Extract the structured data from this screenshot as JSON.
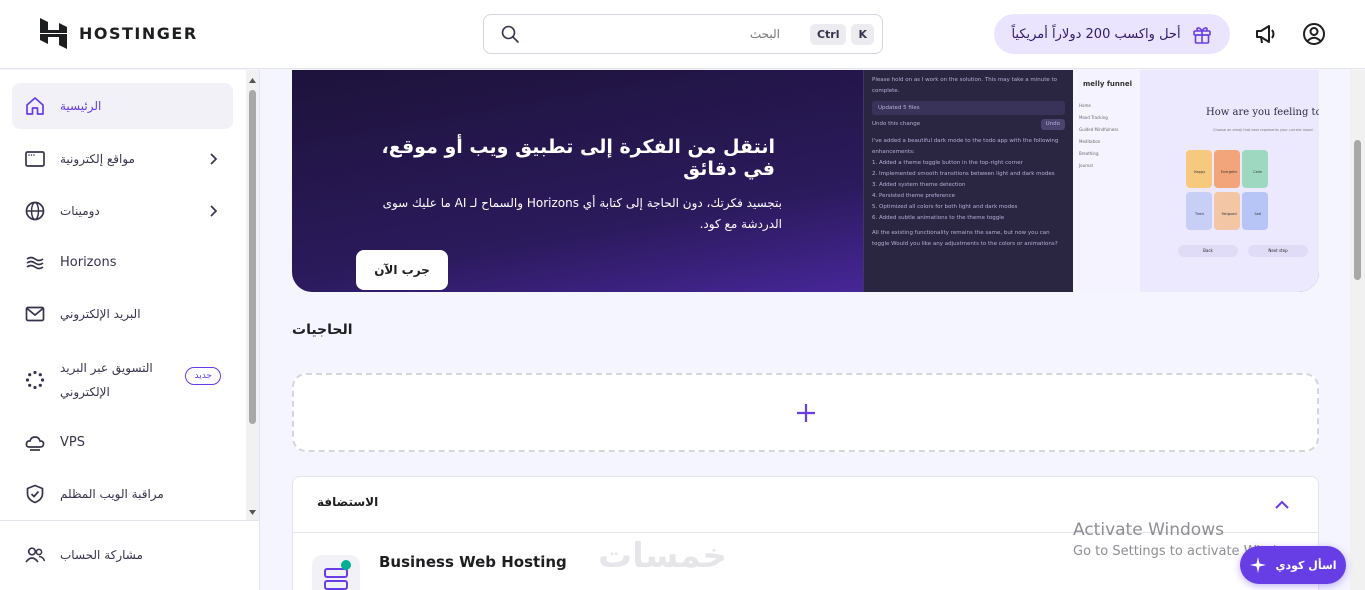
{
  "header": {
    "brand": "HOSTINGER",
    "search_placeholder": "البحث",
    "shortcut_keys": [
      "Ctrl",
      "K"
    ],
    "promo_text": "أحل واكسب 200 دولاراً أمريكياً",
    "icons": [
      "gift-icon",
      "megaphone-icon",
      "user-account-icon",
      "search-icon"
    ]
  },
  "sidebar": {
    "items": [
      {
        "label": "الرئيسية",
        "icon": "home-icon",
        "active": true
      },
      {
        "label": "مواقع إلكترونية",
        "icon": "browser-window-icon",
        "has_chevron": true
      },
      {
        "label": "دومينات",
        "icon": "globe-icon",
        "has_chevron": true
      },
      {
        "label": "Horizons",
        "icon": "horizons-wave-icon"
      },
      {
        "label": "البريد الإلكتروني",
        "icon": "mail-icon"
      },
      {
        "label": "التسويق عبر البريد الإلكتروني",
        "icon": "spinner-dots-icon",
        "badge": "جديد"
      },
      {
        "label": "VPS",
        "icon": "server-cloud-icon"
      },
      {
        "label": "مراقبة الويب المظلم",
        "icon": "shield-check-icon"
      }
    ],
    "footer_item": {
      "label": "مشاركة الحساب",
      "icon": "users-icon"
    }
  },
  "hero": {
    "title": "انتقل من الفكرة إلى تطبيق ويب أو موقع، في دقائق",
    "description": "بتجسيد فكرتك، دون الحاجة إلى كتابة أي Horizons والسماح لـ AI ما عليك سوى الدردشة مع كود.",
    "cta": "جرب الآن",
    "mock_chat": {
      "intro": "Please hold on as I work on the solution. This may take a minute to complete.",
      "updated_files": "Updated 5 files",
      "undo_label": "Undo this change",
      "undo_button": "Undo",
      "summary": "I've added a beautiful dark mode to the todo app with the following enhancements:",
      "steps": [
        "1. Added a theme toggle button in the top-right corner",
        "2. Implemented smooth transitions between light and dark modes",
        "3. Added system theme detection",
        "4. Persisted theme preference",
        "5. Optimized all colors for both light and dark modes",
        "6. Added subtle animations to the theme toggle"
      ],
      "closing": "All the existing functionality remains the same, but now you can toggle Would you like any adjustments to the colors or animations?"
    },
    "mock_app": {
      "logo": "melly funnel",
      "heading": "How are you feeling today",
      "subheading": "Choose an emoji that best represents your current mood",
      "menu": [
        "Home",
        "Mood Tracking",
        "Guided Mindfulness",
        "Meditation",
        "Breathing",
        "Journal"
      ],
      "moods": [
        "Happy",
        "Energetic",
        "Calm",
        "Tired",
        "Fatigued",
        "Sad"
      ],
      "nav": [
        "Back",
        "Next step"
      ]
    }
  },
  "needs": {
    "title": "الحاجيات",
    "add_icon": "plus-icon"
  },
  "hosting": {
    "title": "الاستضافة",
    "service_name": "Business Web Hosting"
  },
  "overlay": {
    "activate_title": "Activate Windows",
    "activate_subtitle": "Go to Settings to activate Windows.",
    "brand_watermark": "خمسات",
    "ask_button": "اسأل كودي"
  },
  "colors": {
    "accent": "#673de6",
    "hero_dark": "#1c1238",
    "promo_bg": "#ebe4ff"
  }
}
